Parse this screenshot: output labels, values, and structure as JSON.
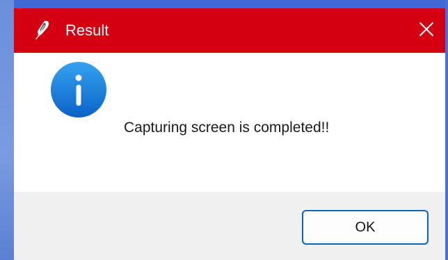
{
  "window": {
    "title": "Result",
    "title_icon": "feather-icon",
    "close_icon": "close-icon",
    "titlebar_color": "#d40012"
  },
  "message": {
    "icon": "info-icon",
    "text": "Capturing screen is completed!!"
  },
  "footer": {
    "ok_label": "OK"
  },
  "colors": {
    "accent": "#0067c0",
    "info_icon_blue": "#1f7ad8",
    "footer_bg": "#f0f0f0"
  }
}
